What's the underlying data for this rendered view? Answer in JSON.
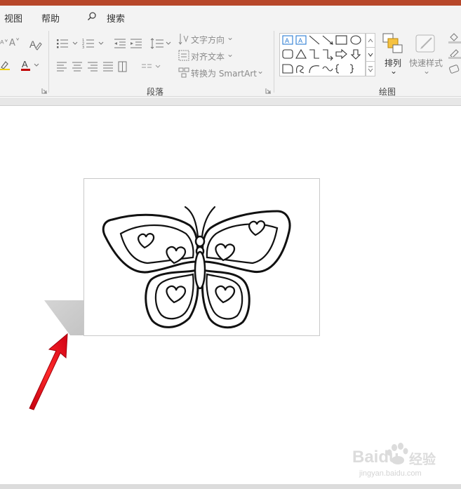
{
  "menu": {
    "view": "视图",
    "help": "帮助",
    "search": "搜索"
  },
  "ribbon": {
    "paragraph": {
      "text_direction": "文字方向",
      "align_text": "对齐文本",
      "convert_smartart": "转换为 SmartArt",
      "group_label": "段落"
    },
    "drawing": {
      "arrange": "排列",
      "quick_styles": "快速样式",
      "group_label": "绘图"
    }
  },
  "watermark": {
    "brand": "Baidu",
    "cn": "经验",
    "url": "jingyan.baidu.com"
  },
  "colors": {
    "title_bar": "#b7472a",
    "annotation_arrow": "#e60012"
  }
}
